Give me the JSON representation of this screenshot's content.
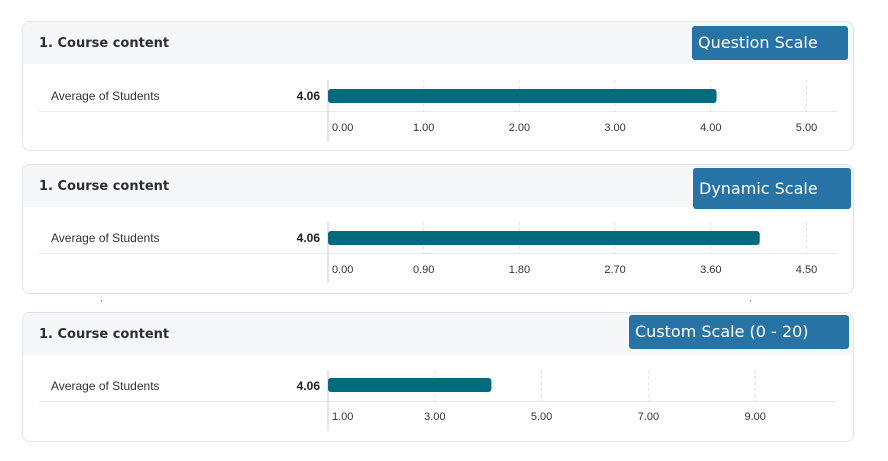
{
  "chart_data": [
    {
      "type": "bar",
      "title": "1. Course content",
      "tag": "Question Scale",
      "categories": [
        "Average of Students"
      ],
      "values": [
        4.06
      ],
      "value_label": "4.06",
      "ticks": [
        0,
        1,
        2,
        3,
        4,
        5
      ],
      "tick_labels": [
        "0.00",
        "1.00",
        "2.00",
        "3.00",
        "4.00",
        "5.00"
      ],
      "xlim": [
        0,
        5
      ],
      "grid": true,
      "bar_color": "#016b7e"
    },
    {
      "type": "bar",
      "title": "1. Course content",
      "tag": "Dynamic Scale",
      "categories": [
        "Average of Students"
      ],
      "values": [
        4.06
      ],
      "value_label": "4.06",
      "ticks": [
        0,
        0.9,
        1.8,
        2.7,
        3.6,
        4.5
      ],
      "tick_labels": [
        "0.00",
        "0.90",
        "1.80",
        "2.70",
        "3.60",
        "4.50"
      ],
      "xlim": [
        0,
        4.5
      ],
      "grid": true,
      "bar_color": "#016b7e"
    },
    {
      "type": "bar",
      "title": "1. Course content",
      "tag": "Custom Scale (0 - 20)",
      "categories": [
        "Average of Students"
      ],
      "values": [
        4.06
      ],
      "value_label": "4.06",
      "ticks": [
        1,
        3,
        5,
        7,
        9
      ],
      "tick_labels": [
        "1.00",
        "3.00",
        "5.00",
        "7.00",
        "9.00"
      ],
      "xlim": [
        1,
        10.5
      ],
      "grid": true,
      "bar_color": "#016b7e"
    }
  ],
  "colors": {
    "accent": "#2873a6",
    "bar": "#016b7e"
  }
}
